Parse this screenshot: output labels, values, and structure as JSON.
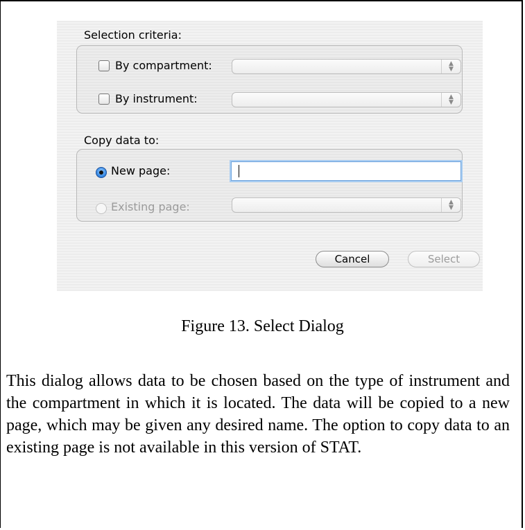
{
  "dialog": {
    "selection": {
      "title": "Selection criteria:",
      "by_compartment_label": "By compartment:",
      "by_instrument_label": "By instrument:"
    },
    "copy": {
      "title": "Copy data to:",
      "new_page_label": "New page:",
      "new_page_value": "",
      "existing_page_label": "Existing page:"
    },
    "buttons": {
      "cancel": "Cancel",
      "select": "Select"
    }
  },
  "figure": {
    "caption": "Figure 13.  Select Dialog"
  },
  "body": {
    "paragraph": "This dialog allows data to be chosen based on the type of instrument and the compartment in which it is located. The data will be copied to a new page, which may be given any desired name. The option to copy data to an existing page is not available in this version of STAT."
  }
}
